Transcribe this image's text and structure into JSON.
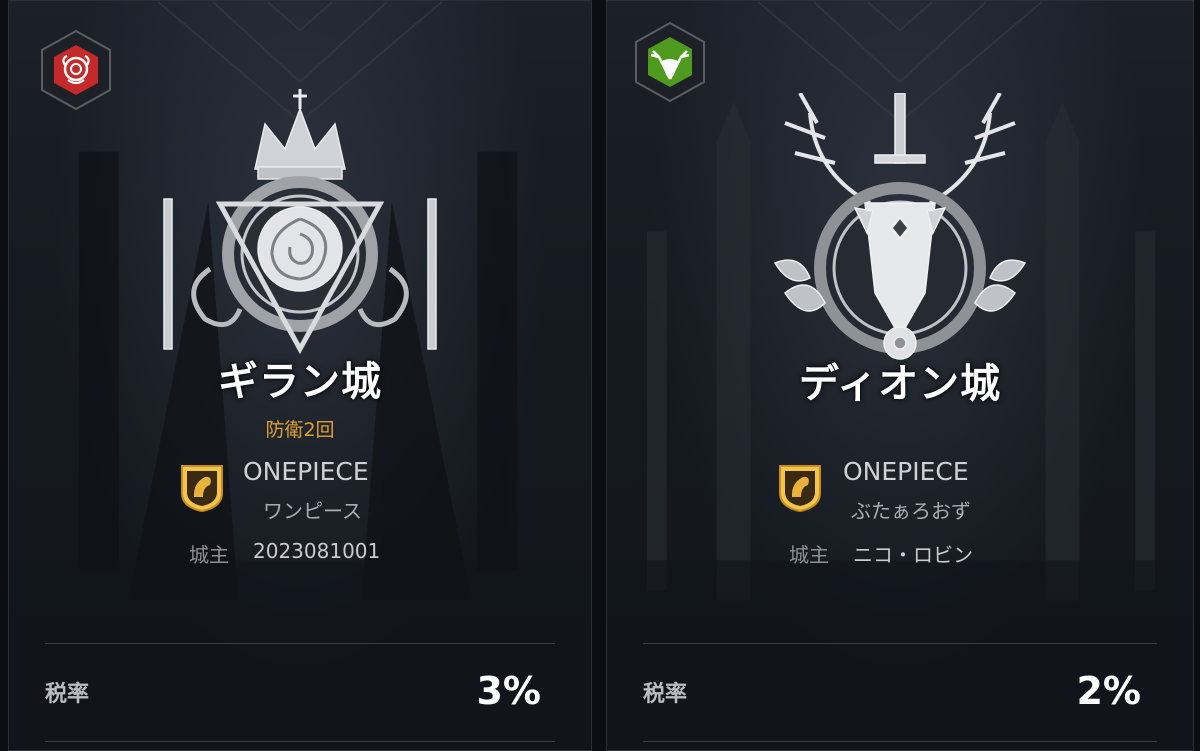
{
  "castles": [
    {
      "faction_icon": "rose-icon",
      "faction_color": "#c42a2a",
      "crest_icon": "rose-crown-crest",
      "name": "ギラン城",
      "defense_text": "防衛2回",
      "guild_icon": "guild-emblem-icon",
      "guild_name": "ONEPIECE",
      "guild_sub": "ワンピース",
      "lord_label": "城主",
      "lord_name": "2023081001",
      "tax_label": "税率",
      "tax_value": "3%"
    },
    {
      "faction_icon": "stag-icon",
      "faction_color": "#4e9a1e",
      "crest_icon": "stag-antler-crest",
      "name": "ディオン城",
      "defense_text": "",
      "guild_icon": "guild-emblem-icon",
      "guild_name": "ONEPIECE",
      "guild_sub": "ぶたぁろおず",
      "lord_label": "城主",
      "lord_name": "ニコ・ロビン",
      "tax_label": "税率",
      "tax_value": "2%"
    }
  ],
  "colors": {
    "accent_gold": "#e0a12c",
    "text_white": "#ffffff",
    "background": "#151920"
  }
}
